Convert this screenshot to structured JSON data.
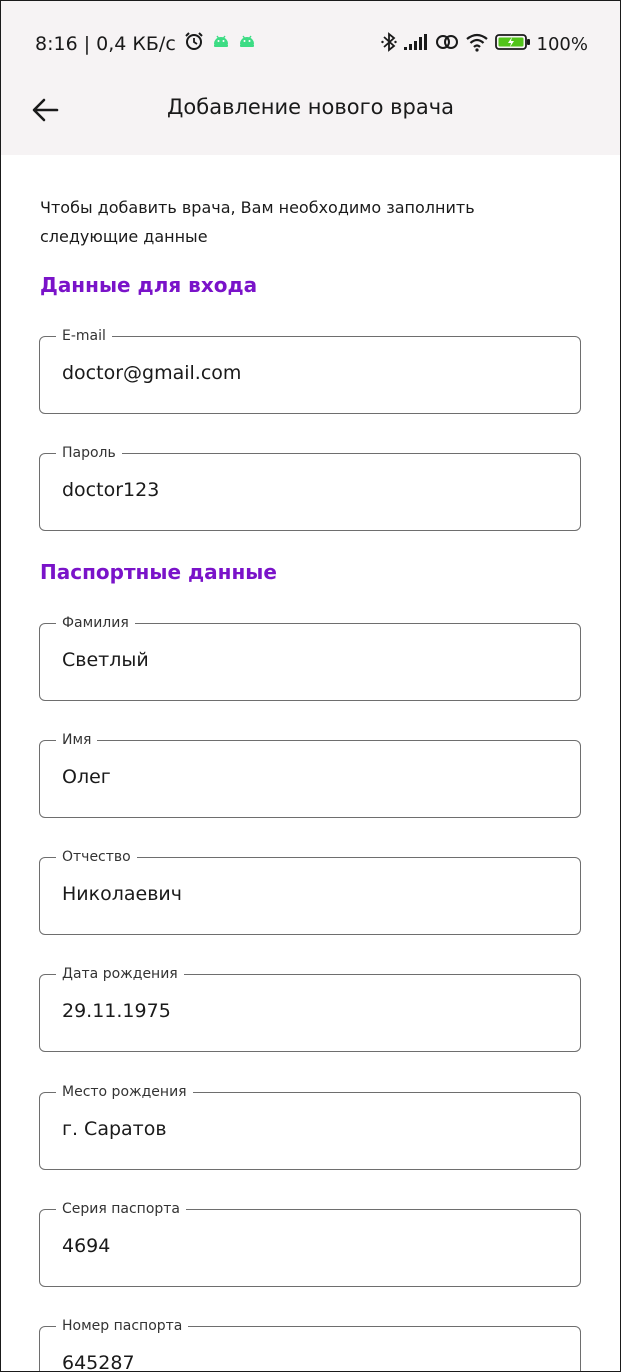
{
  "status_bar": {
    "time_and_speed": "8:16 | 0,4 КБ/с",
    "battery": "100%",
    "icons": [
      "alarm-icon",
      "android-icon",
      "android-icon",
      "bluetooth-icon",
      "signal-icon",
      "link-icon",
      "wifi-icon",
      "battery-charging-icon"
    ]
  },
  "appbar": {
    "title": "Добавление нового врача",
    "back_icon": "arrow-back-icon"
  },
  "intro": {
    "text_line1": "Чтобы добавить врача, Вам необходимо заполнить",
    "text_line2": "следующие данные"
  },
  "sections": {
    "login": "Данные для входа",
    "passport": "Паспортные данные"
  },
  "fields": {
    "email": {
      "label": "E-mail",
      "value": "doctor@gmail.com"
    },
    "password": {
      "label": "Пароль",
      "value": "doctor123"
    },
    "surname": {
      "label": "Фамилия",
      "value": "Светлый"
    },
    "name": {
      "label": "Имя",
      "value": "Олег"
    },
    "patronymic": {
      "label": "Отчество",
      "value": "Николаевич"
    },
    "birth_date": {
      "label": "Дата рождения",
      "value": "29.11.1975"
    },
    "birth_place": {
      "label": "Место рождения",
      "value": "г. Саратов"
    },
    "passport_series": {
      "label": "Серия паспорта",
      "value": "4694"
    },
    "passport_number": {
      "label": "Номер паспорта",
      "value": "645287"
    }
  },
  "colors": {
    "accent": "#7a13c9",
    "topbar_bg": "#f6f3f4",
    "battery_fill": "#52c41a",
    "android_green": "#3ddc84"
  }
}
